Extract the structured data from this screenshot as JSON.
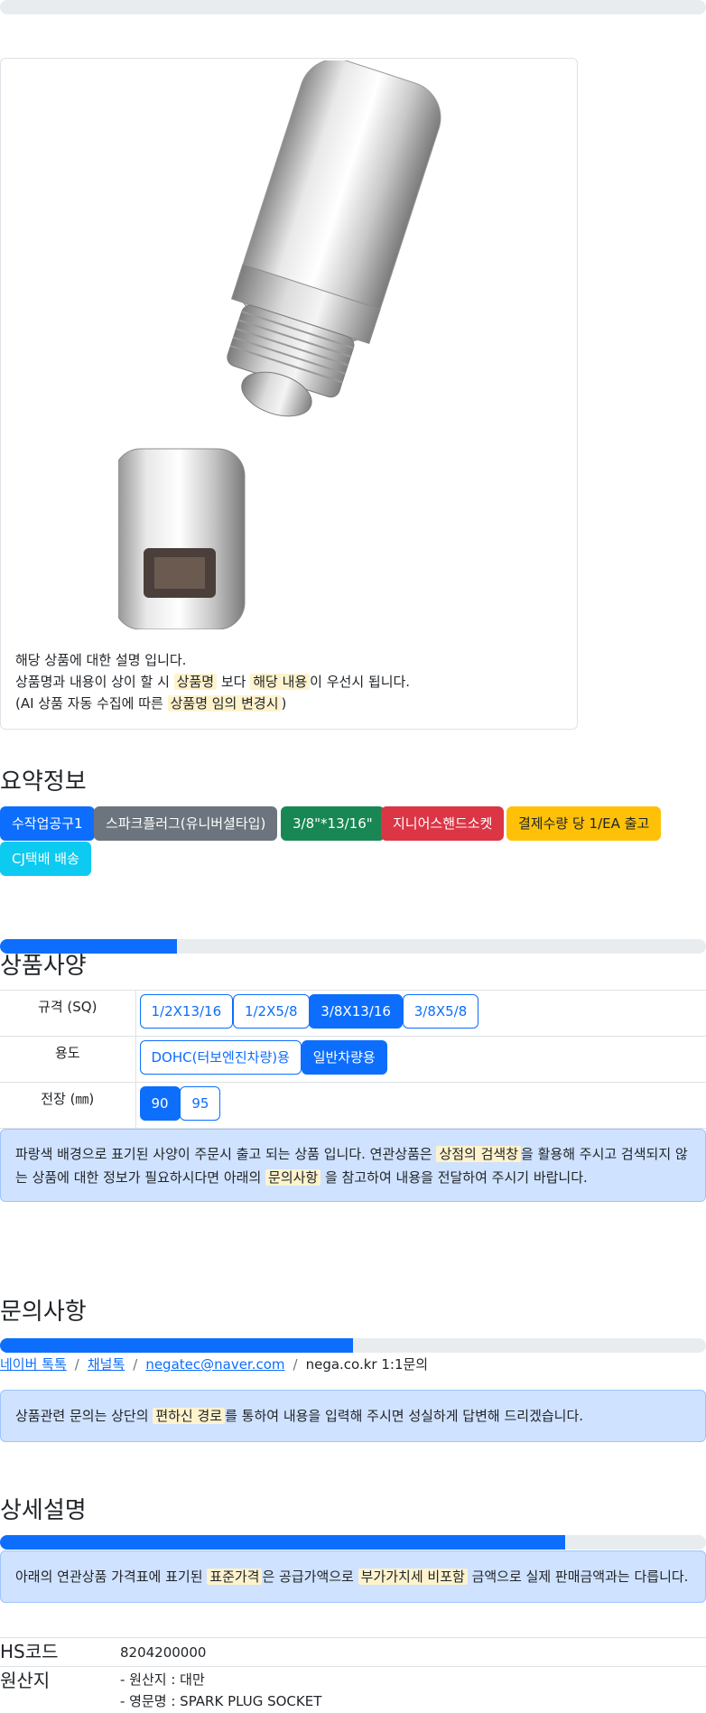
{
  "product": {
    "desc_line1": "해당 상품에 대한 설명 입니다.",
    "desc_line2_a": "상품명과 내용이 상이 할 시 ",
    "desc_line2_mark1": "상품명",
    "desc_line2_b": " 보다 ",
    "desc_line2_mark2": "해당 내용",
    "desc_line2_c": "이 우선시 됩니다.",
    "desc_line3_a": "(AI 상품 자동 수집에 따른 ",
    "desc_line3_mark": "상품명 임의 변경시",
    "desc_line3_b": ")"
  },
  "summary": {
    "title": "요약정보",
    "tags": [
      {
        "label": "수작업공구1",
        "color": "#0d6efd"
      },
      {
        "label": "스파크플러그(유니버셜타입)",
        "color": "#6c757d"
      },
      {
        "label": "3/8\"*13/16\"",
        "color": "#198754"
      },
      {
        "label": "지니어스핸드소켓",
        "color": "#dc3545"
      },
      {
        "label": "결제수량 당 1/EA 출고",
        "color": "#ffc107"
      },
      {
        "label": "CJ택배 배송",
        "color": "#0dcaf0"
      }
    ]
  },
  "spec": {
    "title": "상품사양",
    "progress": 0.25,
    "rows": [
      {
        "label": "규격 (SQ)",
        "options": [
          "1/2X13/16",
          "1/2X5/8",
          "3/8X13/16",
          "3/8X5/8"
        ],
        "selected": 2
      },
      {
        "label": "용도",
        "options": [
          "DOHC(터보엔진차량)용",
          "일반차량용"
        ],
        "selected": 1
      },
      {
        "label": "전장 (㎜)",
        "options": [
          "90",
          "95"
        ],
        "selected": 0
      }
    ],
    "notice_a": "파랑색 배경으로 표기된 사양이 주문시 출고 되는 상품 입니다. 연관상품은 ",
    "notice_mark1": "상점의 검색창",
    "notice_b": "을 활용해 주시고 검색되지 않",
    "notice_c": "는 상품에 대한 정보가 필요하시다면 아래의 ",
    "notice_mark2": "문의사항",
    "notice_d": " 을 참고하여 내용을 전달하여 주시기 바랍니다."
  },
  "inquiry": {
    "title": "문의사항",
    "progress": 0.5,
    "link1": "네이버 톡톡",
    "link2": "채널톡",
    "link3": "negatec@naver.com",
    "text4": "nega.co.kr 1:1문의",
    "notice_a": "상품관련 문의는 상단의 ",
    "notice_mark": "편하신 경로",
    "notice_b": "를 통하여 내용을 입력해 주시면 성실하게 답변해 드리겠습니다."
  },
  "detail": {
    "title": "상세설명",
    "progress": 0.8,
    "notice_a": "아래의 연관상품 가격표에 표기된 ",
    "notice_mark1": "표준가격",
    "notice_b": "은 공급가액으로 ",
    "notice_mark2": "부가가치세 비포함",
    "notice_c": " 금액으로 실제 판매금액과는 다릅니다.",
    "hs_label": "HS코드",
    "hs_value": "8204200000",
    "origin_label": "원산지",
    "origin_line1": "- 원산지 : 대만",
    "origin_line2": "- 영문명 : SPARK PLUG SOCKET"
  }
}
